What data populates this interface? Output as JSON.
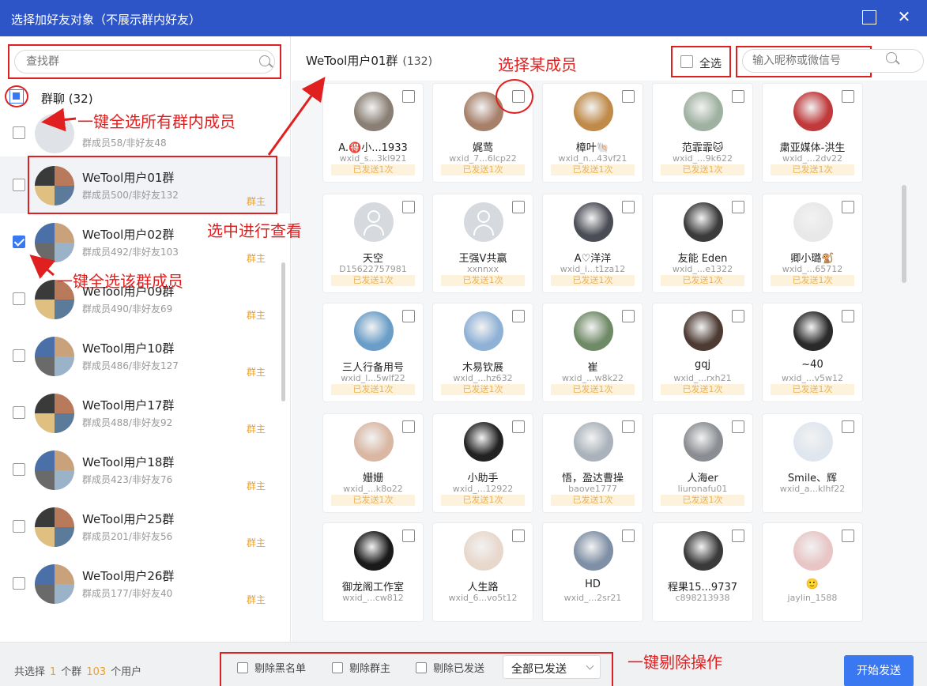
{
  "window": {
    "title": "选择加好友对象（不展示群内好友）",
    "max_icon": "maximize-icon",
    "close_icon": "close-icon",
    "close_glyph": "✕"
  },
  "left": {
    "search_placeholder": "查找群",
    "all_label": "群聊 (32)",
    "groups": [
      {
        "name": "",
        "sub": "群成员58/非好友48",
        "owner": "",
        "checked": false,
        "selected": false
      },
      {
        "name": "WeTool用户01群",
        "sub": "群成员500/非好友132",
        "owner": "群主",
        "checked": false,
        "selected": true
      },
      {
        "name": "WeTool用户02群",
        "sub": "群成员492/非好友103",
        "owner": "群主",
        "checked": true,
        "selected": false
      },
      {
        "name": "WeTool用户09群",
        "sub": "群成员490/非好友69",
        "owner": "群主",
        "checked": false,
        "selected": false
      },
      {
        "name": "WeTool用户10群",
        "sub": "群成员486/非好友127",
        "owner": "群主",
        "checked": false,
        "selected": false
      },
      {
        "name": "WeTool用户17群",
        "sub": "群成员488/非好友92",
        "owner": "群主",
        "checked": false,
        "selected": false
      },
      {
        "name": "WeTool用户18群",
        "sub": "群成员423/非好友76",
        "owner": "群主",
        "checked": false,
        "selected": false
      },
      {
        "name": "WeTool用户25群",
        "sub": "群成员201/非好友56",
        "owner": "群主",
        "checked": false,
        "selected": false
      },
      {
        "name": "WeTool用户26群",
        "sub": "群成员177/非好友40",
        "owner": "群主",
        "checked": false,
        "selected": false
      }
    ]
  },
  "right": {
    "group_title": "WeTool用户01群",
    "group_count": "(132)",
    "select_all": "全选",
    "search_placeholder": "输入昵称或微信号",
    "members": [
      {
        "name": "A.🉐小...1933",
        "id": "wxid_s...3kl921",
        "sent": "已发送1次",
        "color": "#8a7f74"
      },
      {
        "name": "娓莺",
        "id": "wxid_7...6lcp22",
        "sent": "已发送1次",
        "color": "#a7806a"
      },
      {
        "name": "樟叶🐚",
        "id": "wxid_n...43vf21",
        "sent": "已发送1次",
        "color": "#c08a48"
      },
      {
        "name": "范霏霏🐱",
        "id": "wxid_...9k622",
        "sent": "已发送1次",
        "color": "#9fb1a0"
      },
      {
        "name": "粛亚媒体-洪生",
        "id": "wxid_...2dv22",
        "sent": "已发送1次",
        "color": "#c0393b"
      },
      {
        "name": "天空",
        "id": "D15622757981",
        "sent": "已发送1次",
        "color": "placeholder"
      },
      {
        "name": "王强V共赢",
        "id": "xxnnxx",
        "sent": "已发送1次",
        "color": "placeholder"
      },
      {
        "name": "A♡洋洋",
        "id": "wxid_i...t1za12",
        "sent": "已发送1次",
        "color": "#4a4d55"
      },
      {
        "name": "友能 Eden",
        "id": "wxid_...e1322",
        "sent": "已发送1次",
        "color": "#3b3b3b"
      },
      {
        "name": "卿小璐🐒",
        "id": "wxid_...65712",
        "sent": "已发送1次",
        "color": "#e8e8e8"
      },
      {
        "name": "三人行备用号",
        "id": "wxid_l...5wlf22",
        "sent": "已发送1次",
        "color": "#6a9ec8"
      },
      {
        "name": "木易钦展",
        "id": "wxid_...hz632",
        "sent": "已发送1次",
        "color": "#8fb1d6"
      },
      {
        "name": "崔",
        "id": "wxid_...w8k22",
        "sent": "已发送1次",
        "color": "#6f8a66"
      },
      {
        "name": "gqj",
        "id": "wxid_...rxh21",
        "sent": "已发送1次",
        "color": "#4d3a33"
      },
      {
        "name": "~40",
        "id": "wxid_...v5w12",
        "sent": "已发送1次",
        "color": "#2a2a2a"
      },
      {
        "name": "姗姗",
        "id": "wxid_...k8o22",
        "sent": "已发送1次",
        "color": "#d9b7a3"
      },
      {
        "name": "小助手",
        "id": "wxid_...12922",
        "sent": "已发送1次",
        "color": "#222222"
      },
      {
        "name": "悟，盈达曹操",
        "id": "baove1777",
        "sent": "已发送1次",
        "color": "#aab3bb"
      },
      {
        "name": "人海er",
        "id": "liuronafu01",
        "sent": "已发送1次",
        "color": "#8a8d92"
      },
      {
        "name": "Smile、辉",
        "id": "wxid_a...klhf22",
        "sent": "",
        "color": "#dfe6ee"
      },
      {
        "name": "御龙阁工作室",
        "id": "wxid_...cw812",
        "sent": "",
        "color": "#1a1a1a"
      },
      {
        "name": "人生路",
        "id": "wxid_6...vo5t12",
        "sent": "",
        "color": "#e8d8cc"
      },
      {
        "name": "HD",
        "id": "wxid_...2sr21",
        "sent": "",
        "color": "#7f8fa5"
      },
      {
        "name": "程果15...9737",
        "id": "c898213938",
        "sent": "",
        "color": "#3a3a3a"
      },
      {
        "name": "⁠🙂",
        "id": "jaylin_1588",
        "sent": "",
        "color": "#e8c6c6"
      }
    ]
  },
  "footer": {
    "summary_prefix": "共选择",
    "group_count": "1",
    "group_unit": "个群",
    "user_count": "103",
    "user_unit": "个用户",
    "opt_blacklist": "剔除黑名单",
    "opt_owner": "剔除群主",
    "opt_sent": "剔除已发送",
    "sent_filter": "全部已发送",
    "start_button": "开始发送"
  },
  "annotations": {
    "select_all_group_members": "一键全选所有群内成员",
    "select_member": "选择某成员",
    "view_selected": "选中进行查看",
    "select_group_members": "一键全选该群成员",
    "remove_ops": "一键剔除操作"
  },
  "colors": {
    "titlebar": "#2e55c8",
    "accent": "#3a78f2",
    "annotation_red": "#e02020",
    "owner_orange": "#f0a020"
  }
}
